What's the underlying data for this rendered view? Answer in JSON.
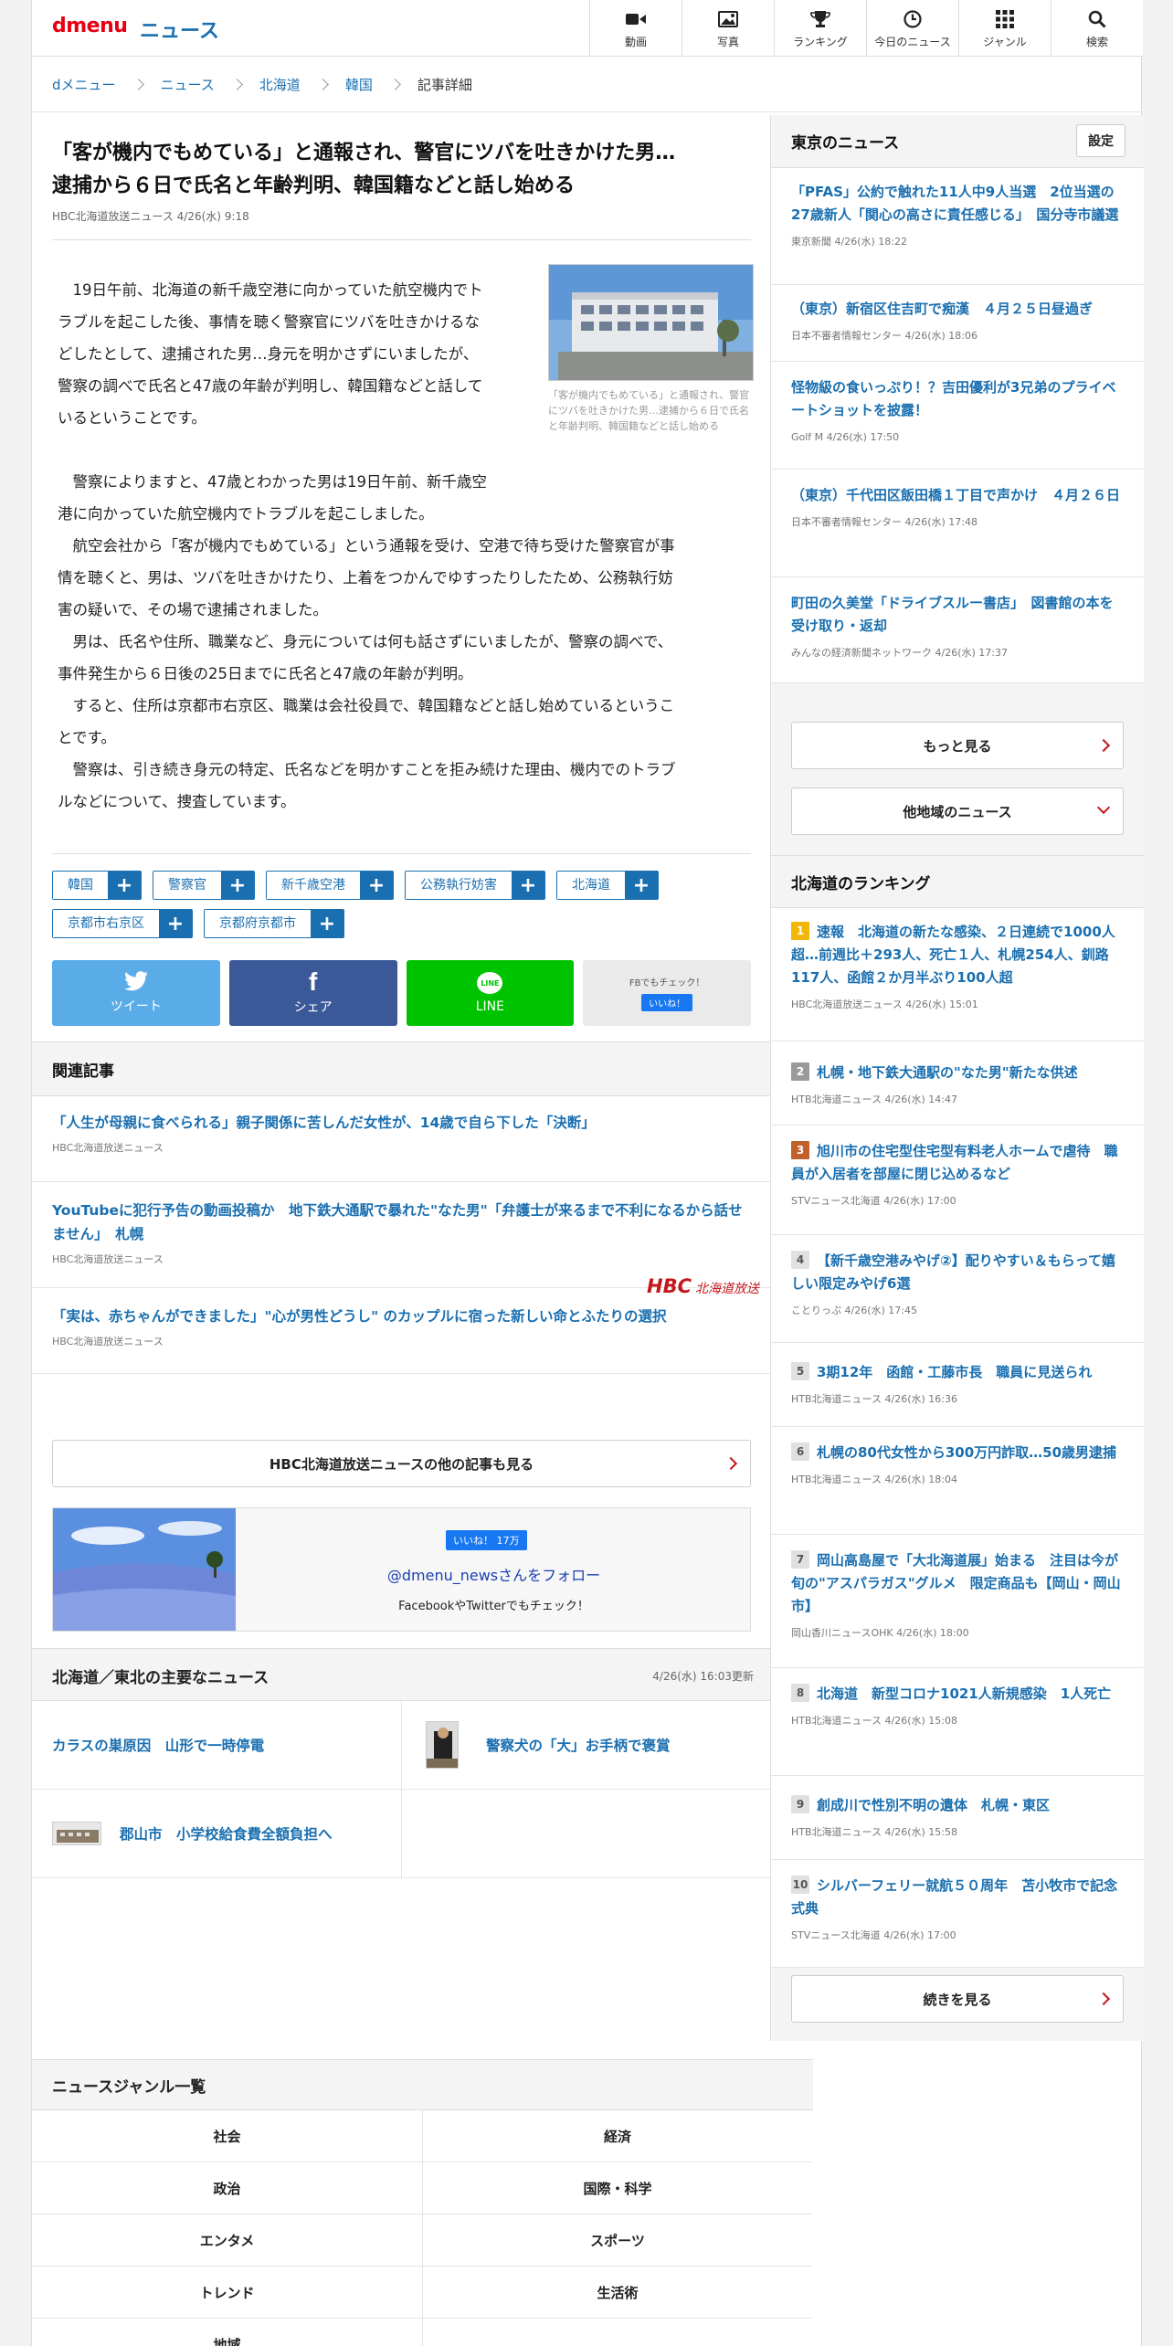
{
  "header": {
    "logo": "dmenu",
    "section": "ニュース",
    "nav": [
      {
        "label": "動画",
        "icon": "video-camera-icon"
      },
      {
        "label": "写真",
        "icon": "photo-icon"
      },
      {
        "label": "ランキング",
        "icon": "trophy-icon"
      },
      {
        "label": "今日のニュース",
        "icon": "clock-icon"
      },
      {
        "label": "ジャンル",
        "icon": "grid-icon"
      },
      {
        "label": "検索",
        "icon": "search-icon"
      }
    ]
  },
  "breadcrumb": [
    "dメニュー",
    "ニュース",
    "北海道",
    "韓国",
    "記事詳細"
  ],
  "article": {
    "title_line1": "「客が機内でもめている」と通報され、警官にツバを吐きかけた男…",
    "title_line2": "逮捕から６日で氏名と年齢判明、韓国籍などと話し始める",
    "source": "HBC北海道放送ニュース",
    "date": "4/26(水) 9:18",
    "lead_lines": [
      "19日午前、北海道の新千歳空港に向かっていた航空機内でト",
      "ラブルを起こした後、事情を聴く警察官にツバを吐きかけるな",
      "どしたとして、逮捕された男…身元を明かさずにいましたが、",
      "警察の調べで氏名と47歳の年齢が判明し、韓国籍などと話して",
      "いるということです。"
    ],
    "photo_caption": "「客が機内でもめている」と通報され、警官にツバを吐きかけた男…逮捕から６日で氏名と年齢判明、韓国籍などと話し始める",
    "body_lines": [
      "警察によりますと、47歳とわかった男は19日午前、新千歳空",
      "港に向かっていた航空機内でトラブルを起こしました。",
      "航空会社から「客が機内でもめている」という通報を受け、空港で待ち受けた警察官が事",
      "情を聴くと、男は、ツバを吐きかけたり、上着をつかんでゆすったりしたため、公務執行妨",
      "害の疑いで、その場で逮捕されました。",
      "男は、氏名や住所、職業など、身元については何も話さずにいましたが、警察の調べで、",
      "事件発生から６日後の25日までに氏名と47歳の年齢が判明。",
      "すると、住所は京都市右京区、職業は会社役員で、韓国籍などと話し始めているというこ",
      "とです。",
      "警察は、引き続き身元の特定、氏名などを明かすことを拒み続けた理由、機内でのトラブ",
      "ルなどについて、捜査しています。"
    ],
    "tags": [
      "韓国",
      "警察官",
      "新千歳空港",
      "公務執行妨害",
      "北海道",
      "京都市右京区",
      "京都府京都市"
    ]
  },
  "share": {
    "tweet": "ツイート",
    "facebook": "シェア",
    "line_top": "LINE",
    "line": "LINE",
    "fb_check": "FBでもチェック！",
    "fb_like": "いいね！"
  },
  "related": {
    "heading": "関連記事",
    "items": [
      {
        "title": "「人生が母親に食べられる」親子関係に苦しんだ女性が、14歳で自ら下した「決断」",
        "source": "HBC北海道放送ニュース"
      },
      {
        "title": "YouTubeに犯行予告の動画投稿か　地下鉄大通駅で暴れた\"なた男\"「弁護士が来るまで不利になるから話せません」　札幌",
        "source": "HBC北海道放送ニュース"
      },
      {
        "title": "「実は、赤ちゃんができました」\"心が男性どうし\" のカップルに宿った新しい命とふたりの選択",
        "source": "HBC北海道放送ニュース"
      }
    ]
  },
  "provider": {
    "logo": "HBC",
    "logo_sub": "北海道放送",
    "more": "HBC北海道放送ニュースの他の記事も見る"
  },
  "fb_box": {
    "like": "いいね！ 17万",
    "follow": "@dmenu_newsさんをフォロー",
    "check": "FacebookやTwitterでもチェック！"
  },
  "regional": {
    "heading": "北海道／東北の主要なニュース",
    "updated": "4/26(水) 16:03更新",
    "items": [
      "カラスの巣原因　山形で一時停電",
      "警察犬の「大」お手柄で褒賞",
      "郡山市　小学校給食費全額負担へ"
    ]
  },
  "sidebar": {
    "tokyo_heading": "東京のニュース",
    "settings": "設定",
    "tokyo": [
      {
        "title": "「PFAS」公約で触れた11人中9人当選　2位当選の27歳新人「関心の高さに責任感じる」　国分寺市議選",
        "source": "東京新聞",
        "date": "4/26(水) 18:22"
      },
      {
        "title": "（東京）新宿区住吉町で痴漢　４月２５日昼過ぎ",
        "source": "日本不審者情報センター",
        "date": "4/26(水) 18:06"
      },
      {
        "title": "怪物級の食いっぷり！？吉田優利が3兄弟のプライベートショットを披露！",
        "source": "Golf M",
        "date": "4/26(水) 17:50"
      },
      {
        "title": "（東京）千代田区飯田橋１丁目で声かけ　４月２６日",
        "source": "日本不審者情報センター",
        "date": "4/26(水) 17:48"
      },
      {
        "title": "町田の久美堂「ドライブスルー書店」　図書館の本を受け取り・返却",
        "source": "みんなの経済新聞ネットワーク",
        "date": "4/26(水) 17:37"
      }
    ],
    "more": "もっと見る",
    "other_regions": "他地域のニュース",
    "ranking_heading": "北海道のランキング",
    "ranking": [
      {
        "rank": "1",
        "title": "速報　北海道の新たな感染、２日連続で1000人超…前週比＋293人、死亡１人、札幌254人、釧路117人、函館２か月半ぶり100人超",
        "source": "HBC北海道放送ニュース",
        "date": "4/26(水) 15:01"
      },
      {
        "rank": "2",
        "title": "札幌・地下鉄大通駅の\"なた男\"新たな供述",
        "source": "HTB北海道ニュース",
        "date": "4/26(水) 14:47"
      },
      {
        "rank": "3",
        "title": "旭川市の住宅型住宅型有料老人ホームで虐待　職員が入居者を部屋に閉じ込めるなど",
        "source": "STVニュース北海道",
        "date": "4/26(水) 17:00"
      },
      {
        "rank": "4",
        "title": "【新千歳空港みやげ②】配りやすい＆もらって嬉しい限定みやげ6選",
        "source": "ことりっぷ",
        "date": "4/26(水) 17:45"
      },
      {
        "rank": "5",
        "title": "3期12年　函館・工藤市長　職員に見送られ",
        "source": "HTB北海道ニュース",
        "date": "4/26(水) 16:36"
      },
      {
        "rank": "6",
        "title": "札幌の80代女性から300万円詐取…50歳男逮捕",
        "source": "HTB北海道ニュース",
        "date": "4/26(水) 18:04"
      },
      {
        "rank": "7",
        "title": "岡山高島屋で「大北海道展」始まる　注目は今が旬の\"アスパラガス\"グルメ　限定商品も【岡山・岡山市】",
        "source": "岡山香川ニュースOHK",
        "date": "4/26(水) 18:00"
      },
      {
        "rank": "8",
        "title": "北海道　新型コロナ1021人新規感染　1人死亡",
        "source": "HTB北海道ニュース",
        "date": "4/26(水) 15:08"
      },
      {
        "rank": "9",
        "title": "創成川で性別不明の遺体　札幌・東区",
        "source": "HTB北海道ニュース",
        "date": "4/26(水) 15:58"
      },
      {
        "rank": "10",
        "title": "シルバーフェリー就航５０周年　苫小牧市で記念式典",
        "source": "STVニュース北海道",
        "date": "4/26(水) 17:00"
      }
    ],
    "ranking_more": "続きを見る"
  },
  "genre": {
    "heading": "ニュースジャンル一覧",
    "items": [
      "社会",
      "経済",
      "政治",
      "国際・科学",
      "エンタメ",
      "スポーツ",
      "トレンド",
      "生活術",
      "地域",
      ""
    ]
  },
  "colors": {
    "brand_red": "#e60012",
    "link_blue": "#1a6fb0",
    "hbc_red": "#c4161c"
  }
}
